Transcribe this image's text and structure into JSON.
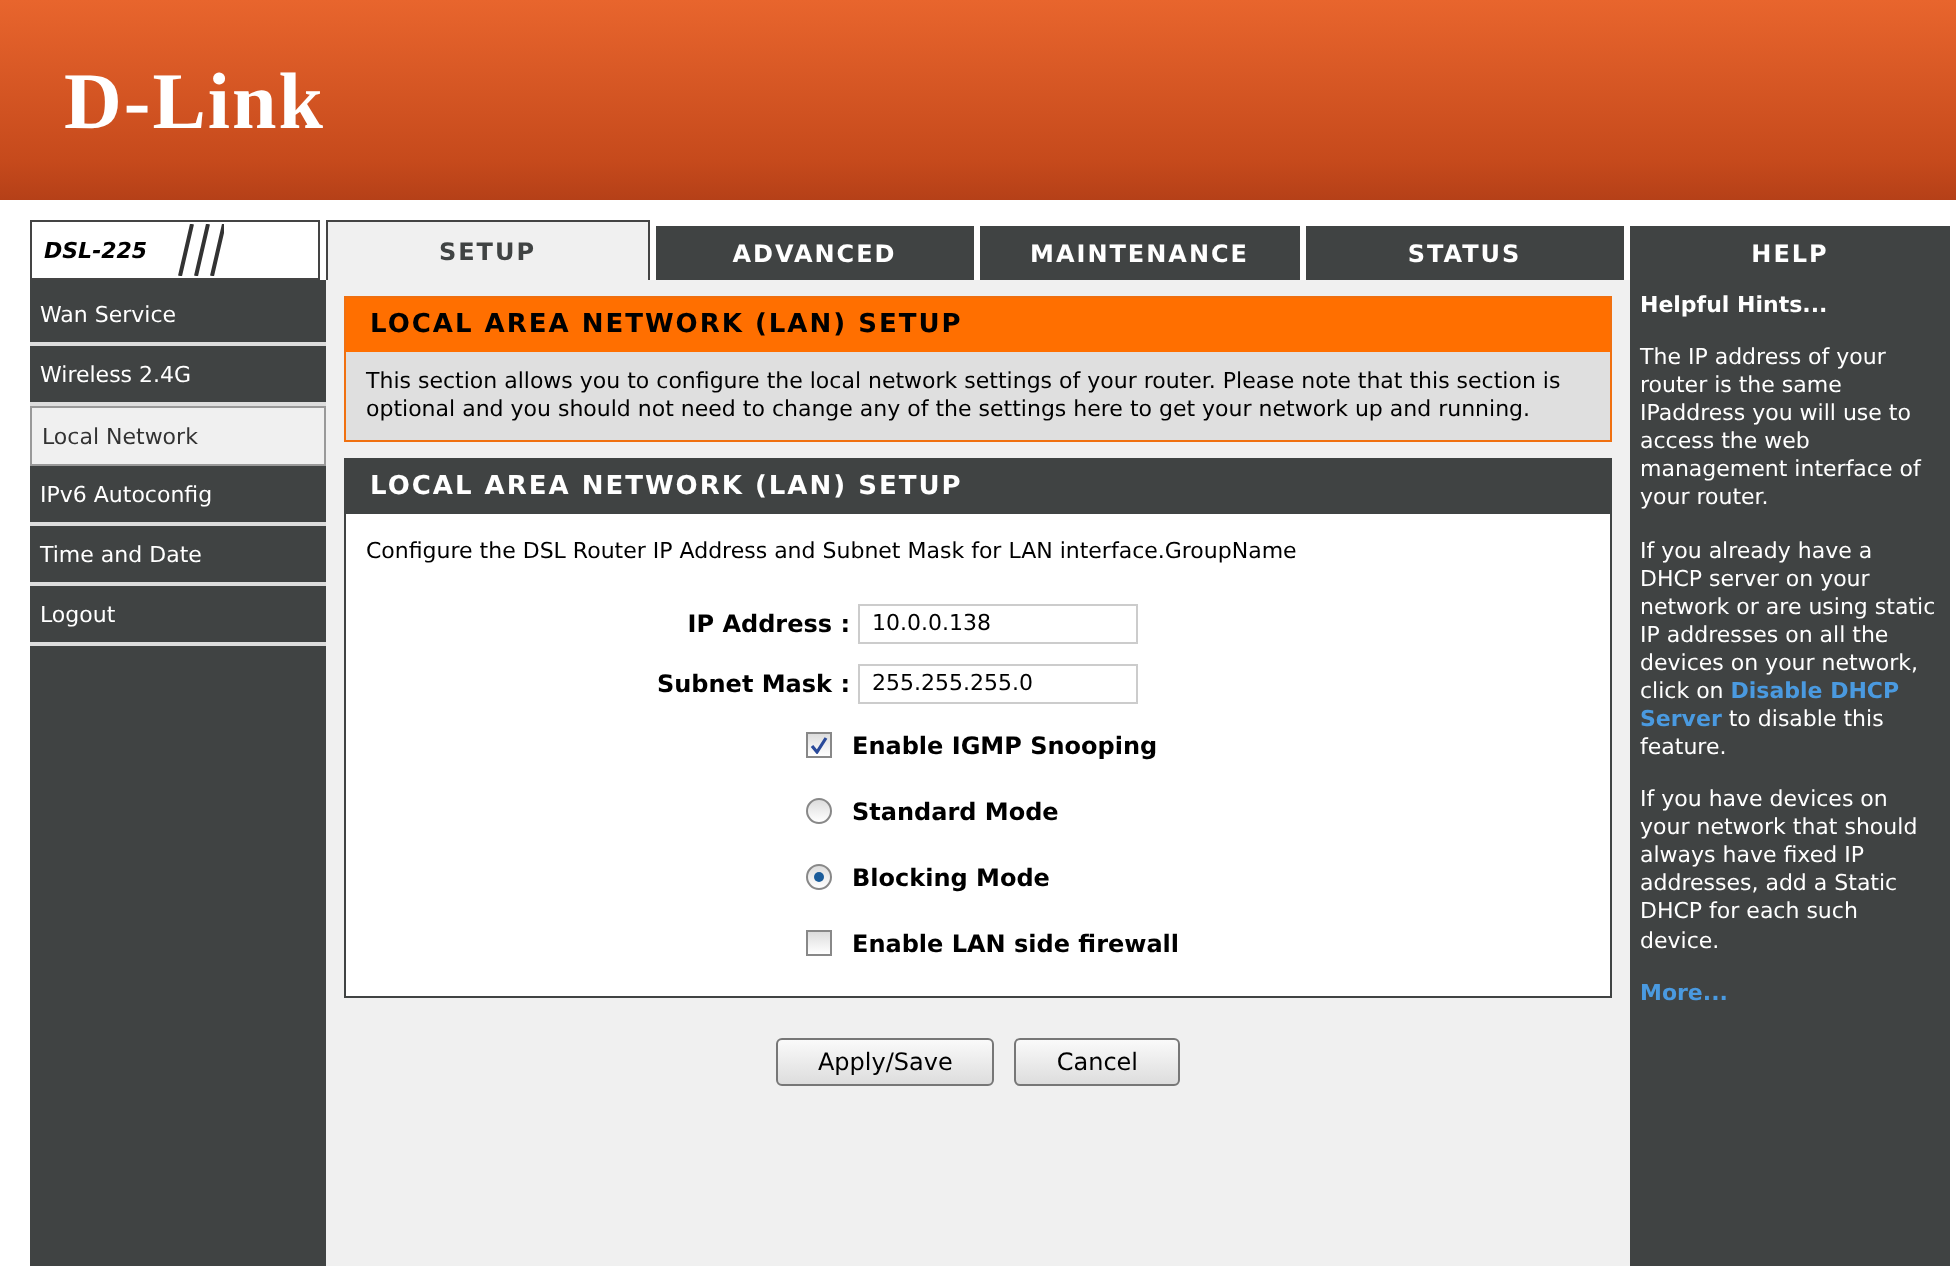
{
  "header": {
    "logo": "D-Link"
  },
  "model": "DSL-225",
  "tabs": [
    {
      "label": "SETUP",
      "selected": true
    },
    {
      "label": "ADVANCED",
      "selected": false
    },
    {
      "label": "MAINTENANCE",
      "selected": false
    },
    {
      "label": "STATUS",
      "selected": false
    }
  ],
  "help_tab": "HELP",
  "sidebar": {
    "items": [
      {
        "label": "Wan Service",
        "selected": false
      },
      {
        "label": "Wireless 2.4G",
        "selected": false
      },
      {
        "label": "Local Network",
        "selected": true
      },
      {
        "label": "IPv6 Autoconfig",
        "selected": false
      },
      {
        "label": "Time and Date",
        "selected": false
      },
      {
        "label": "Logout",
        "selected": false
      }
    ]
  },
  "intro": {
    "title": "LOCAL AREA NETWORK (LAN) SETUP",
    "text": "This section allows you to configure the local network settings of your router. Please note that this section is optional and you should not need to change any of the settings here to get your network up and running."
  },
  "form": {
    "title": "LOCAL AREA NETWORK (LAN) SETUP",
    "description": "Configure the DSL Router IP Address and Subnet Mask for LAN interface.GroupName",
    "fields": [
      {
        "label": "IP Address :",
        "value": "10.0.0.138"
      },
      {
        "label": "Subnet Mask :",
        "value": "255.255.255.0"
      }
    ],
    "options": [
      {
        "kind": "checkbox",
        "label": "Enable IGMP Snooping",
        "checked": true
      },
      {
        "kind": "radio",
        "label": "Standard Mode",
        "selected": false
      },
      {
        "kind": "radio",
        "label": "Blocking Mode",
        "selected": true
      },
      {
        "kind": "checkbox",
        "label": "Enable LAN side firewall",
        "checked": false
      }
    ]
  },
  "buttons": [
    "Apply/Save",
    "Cancel"
  ],
  "help": {
    "title": "Helpful Hints...",
    "paragraphs": [
      "The IP address of your router is the same IPaddress you will use to access the web management interface of your router.",
      "If you already have a DHCP server on your network or are using static IP addresses on all the devices on your network, click on **Disable DHCP Server** to disable this feature.",
      "If you have devices on your network that should always have fixed IP addresses, add a Static DHCP for each such device."
    ],
    "more": "More..."
  }
}
